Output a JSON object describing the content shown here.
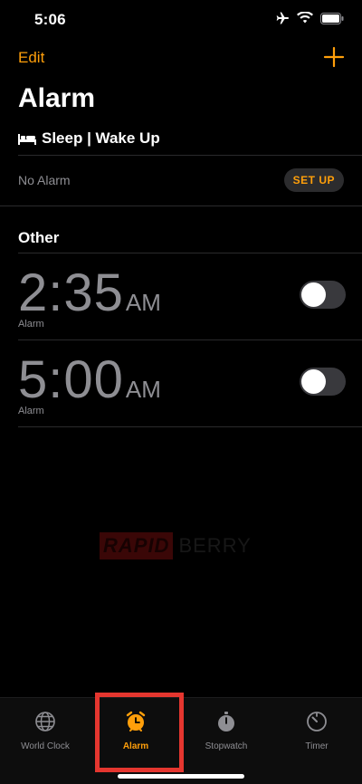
{
  "status": {
    "time": "5:06"
  },
  "nav": {
    "edit_label": "Edit"
  },
  "page": {
    "title": "Alarm"
  },
  "sleep": {
    "header": "Sleep | Wake Up",
    "no_alarm": "No Alarm",
    "setup_label": "SET UP"
  },
  "other": {
    "header": "Other"
  },
  "alarms": [
    {
      "digits": "2:35",
      "ampm": "AM",
      "label": "Alarm",
      "enabled": false
    },
    {
      "digits": "5:00",
      "ampm": "AM",
      "label": "Alarm",
      "enabled": false
    }
  ],
  "watermark": {
    "part1": "RAPID",
    "part2": "BERRY"
  },
  "tabs": [
    {
      "label": "World Clock",
      "icon": "globe-icon",
      "active": false
    },
    {
      "label": "Alarm",
      "icon": "alarm-clock-icon",
      "active": true
    },
    {
      "label": "Stopwatch",
      "icon": "stopwatch-icon",
      "active": false
    },
    {
      "label": "Timer",
      "icon": "timer-icon",
      "active": false
    }
  ],
  "colors": {
    "accent": "#ff9f0a",
    "highlight": "#e5362f",
    "secondary_text": "#8e8e93"
  }
}
